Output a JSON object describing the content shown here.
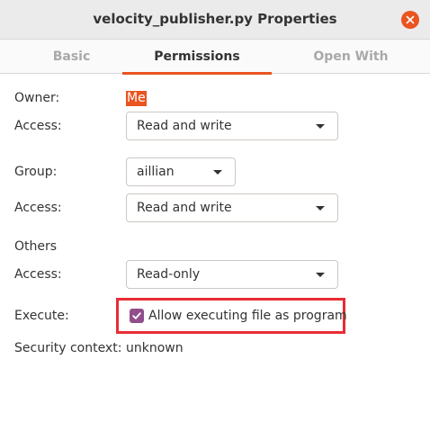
{
  "window": {
    "title": "velocity_publisher.py Properties",
    "close_icon": "close-icon"
  },
  "tabs": [
    {
      "label": "Basic",
      "active": false
    },
    {
      "label": "Permissions",
      "active": true
    },
    {
      "label": "Open With",
      "active": false
    }
  ],
  "permissions": {
    "owner_label": "Owner:",
    "owner_value": "Me",
    "owner_access_label": "Access:",
    "owner_access_value": "Read and write",
    "group_label": "Group:",
    "group_value": "aillian",
    "group_access_label": "Access:",
    "group_access_value": "Read and write",
    "others_label": "Others",
    "others_access_label": "Access:",
    "others_access_value": "Read-only",
    "execute_label": "Execute:",
    "execute_checkbox_label": "Allow executing file as program",
    "execute_checked": true,
    "security_label": "Security context:",
    "security_value": "unknown"
  },
  "colors": {
    "accent": "#e95420",
    "checkbox": "#924d8b",
    "highlight_box": "#e82c36"
  }
}
